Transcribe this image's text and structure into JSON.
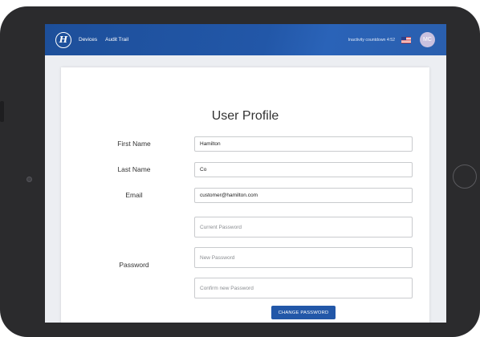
{
  "topbar": {
    "logo_glyph": "H",
    "nav": [
      {
        "label": "Devices"
      },
      {
        "label": "Audit Trail"
      }
    ],
    "countdown": "Inactivity countdown 4:52",
    "avatar_initials": "MC",
    "accent_color": "#2257a8"
  },
  "profile": {
    "title": "User Profile",
    "first_name": {
      "label": "First Name",
      "value": "Hamilton"
    },
    "last_name": {
      "label": "Last Name",
      "value": "Co"
    },
    "email": {
      "label": "Email",
      "value": "customer@hamilton.com"
    },
    "password": {
      "label": "Password",
      "current_placeholder": "Current Password",
      "new_placeholder": "New Password",
      "confirm_placeholder": "Confirm new Password"
    },
    "change_password_label": "CHANGE PASSWORD"
  }
}
